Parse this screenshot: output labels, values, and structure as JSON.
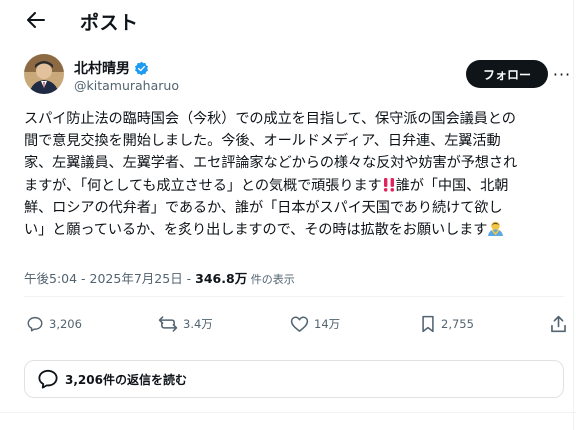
{
  "header": {
    "back_icon": "arrow-left-icon",
    "title": "ポスト"
  },
  "author": {
    "name": "北村晴男",
    "handle": "@kitamuraharuo",
    "verified": true,
    "avatar_icon": "user-avatar",
    "follow_label": "フォロー",
    "more_label": "···"
  },
  "post": {
    "text_part1": "スパイ防止法の臨時国会（今秋）での成立を目指して、保守派の国会議員との\n間で意見交換を開始しました。今後、オールドメディア、日弁連、左翼活動\n家、左翼議員、左翼学者、エセ評論家などからの様々な反対や妨害が予想され\nますが、「何としても成立させる」との気概で頑張ります",
    "text_part2": "誰が「中国、北朝\n鮮、ロシアの代弁者」であるか、誰が「日本がスパイ天国であり続けて欲し\nい」と願っているか、を炙り出しますので、その時は拡散をお願いします",
    "emoji_exclamation": "double-exclamation-icon",
    "emoji_pray": "bowing-person-icon"
  },
  "meta": {
    "time": "午後5:04 - 2025年7月25日 - ",
    "views_number": "346.8万",
    "views_label": " 件の表示"
  },
  "actions": {
    "replies": "3,206",
    "reposts": "3.4万",
    "likes": "14万",
    "bookmarks": "2,755",
    "share_icon": "share-icon"
  },
  "replies_button": {
    "label": "3,206件の返信を読む"
  },
  "colors": {
    "text": "#0f1419",
    "muted": "#536471",
    "verified": "#1d9bf0",
    "follow_bg": "#0f1419",
    "exclamation": "#e0245e"
  }
}
